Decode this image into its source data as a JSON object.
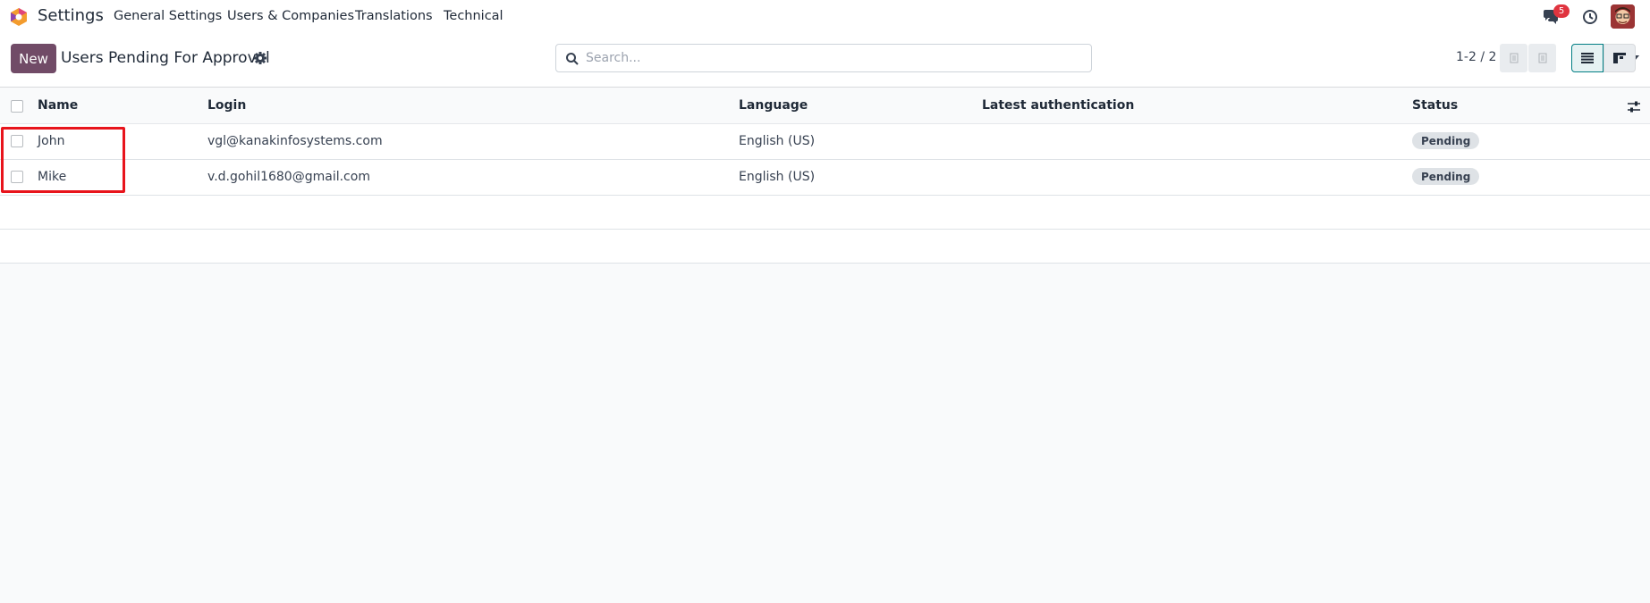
{
  "nav": {
    "app_name": "Settings",
    "menu": [
      "General Settings",
      "Users & Companies",
      "Translations",
      "Technical"
    ],
    "message_count": "5"
  },
  "control": {
    "new_label": "New",
    "title": "Users Pending For Approval",
    "search_placeholder": "Search...",
    "pager": "1-2 / 2"
  },
  "table": {
    "columns": [
      "Name",
      "Login",
      "Language",
      "Latest authentication",
      "Status"
    ],
    "rows": [
      {
        "name": "John",
        "login": "vgl@kanakinfosystems.com",
        "language": "English (US)",
        "latest_auth": "",
        "status": "Pending"
      },
      {
        "name": "Mike",
        "login": "v.d.gohil1680@gmail.com",
        "language": "English (US)",
        "latest_auth": "",
        "status": "Pending"
      }
    ]
  },
  "colors": {
    "brand": "#714b67",
    "badge": "#e0343f",
    "highlight": "#e8141c",
    "active_view": "#017e84"
  }
}
